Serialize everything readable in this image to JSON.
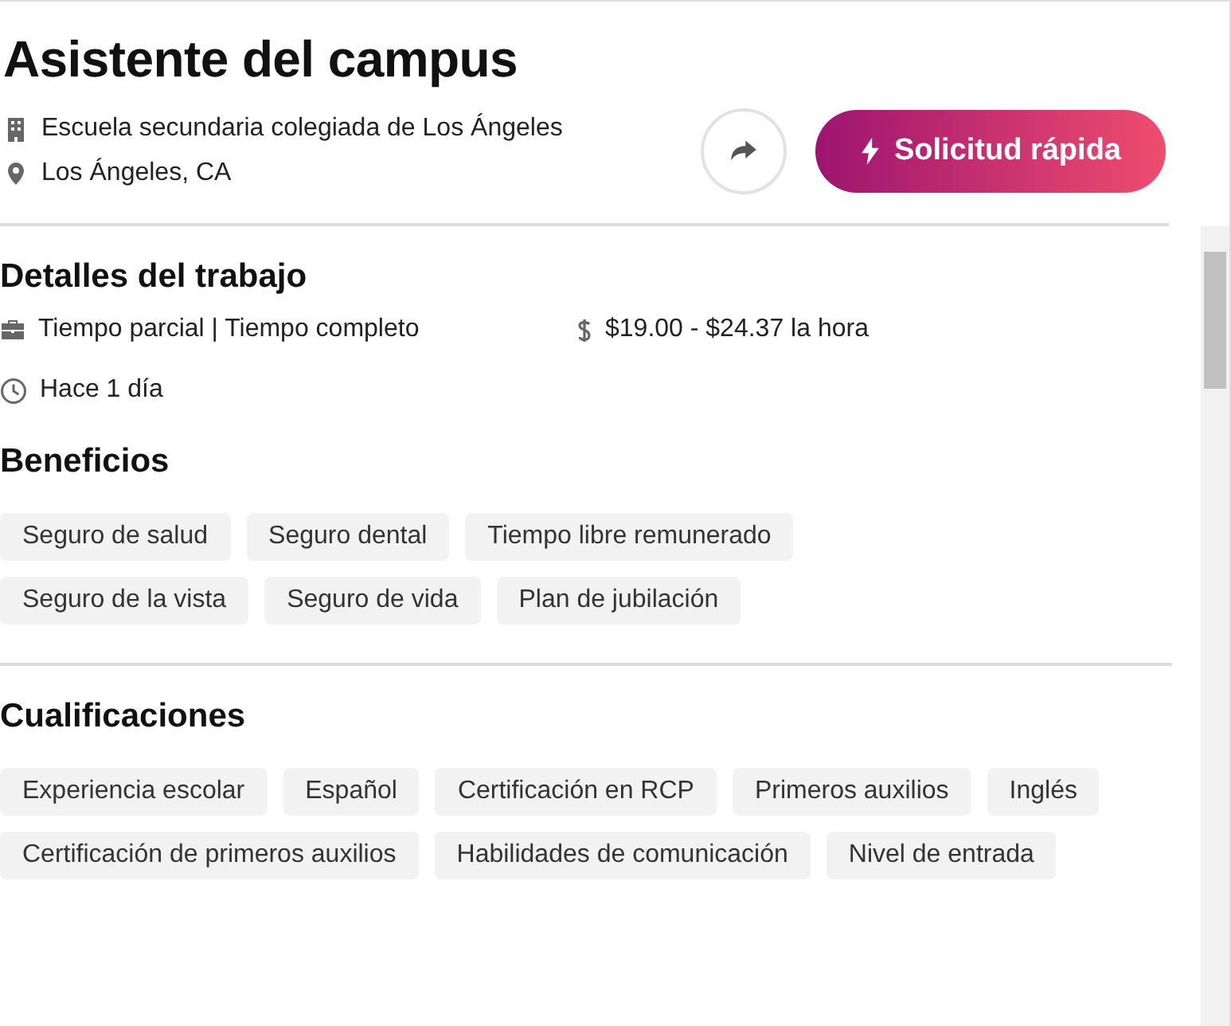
{
  "job": {
    "title": "Asistente del campus",
    "employer": "Escuela secundaria colegiada de Los Ángeles",
    "location": "Los Ángeles, CA"
  },
  "apply_button": {
    "label": "Solicitud rápida"
  },
  "details": {
    "heading": "Detalles del trabajo",
    "schedule": "Tiempo parcial | Tiempo completo",
    "pay": "$19.00 - $24.37 la hora",
    "posted": "Hace 1 día"
  },
  "benefits": {
    "heading": "Beneficios",
    "tags": [
      "Seguro de salud",
      "Seguro dental",
      "Tiempo libre remunerado",
      "Seguro de la vista",
      "Seguro de vida",
      "Plan de jubilación"
    ]
  },
  "qualifications": {
    "heading": "Cualificaciones",
    "tags": [
      "Experiencia escolar",
      "Español",
      "Certificación en RCP",
      "Primeros auxilios",
      "Inglés",
      "Certificación de primeros auxilios",
      "Habilidades de comunicación",
      "Nivel de entrada"
    ]
  }
}
